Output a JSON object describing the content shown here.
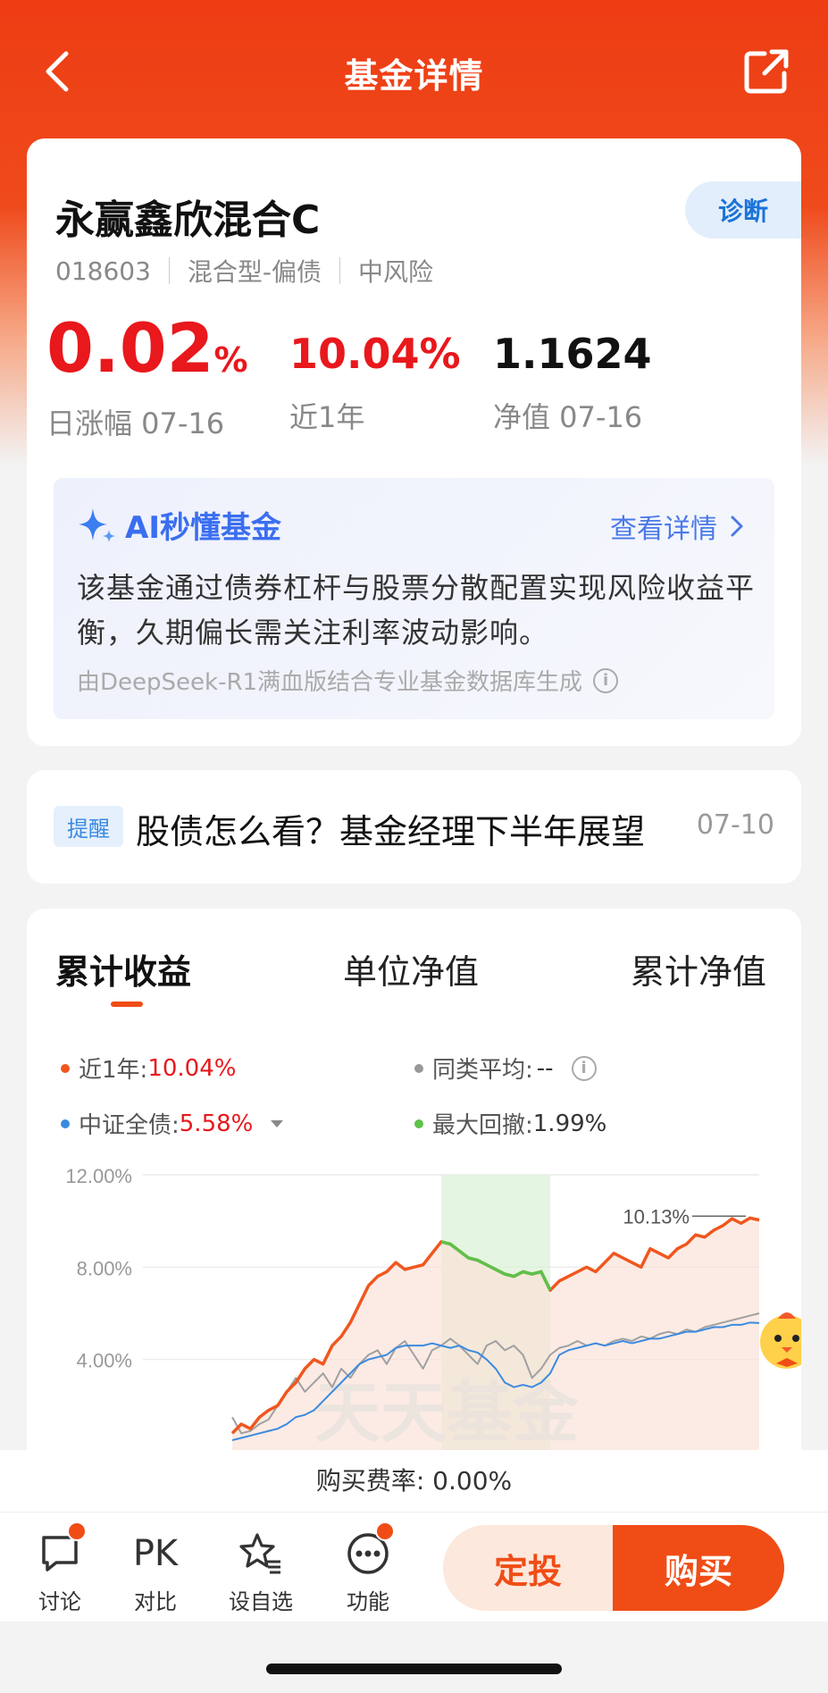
{
  "nav": {
    "title": "基金详情",
    "back_icon": "chevron-left-icon",
    "share_icon": "share-icon"
  },
  "fund": {
    "name": "永赢鑫欣混合C",
    "code": "018603",
    "type": "混合型-偏债",
    "risk": "中风险",
    "diagnose_label": "诊断",
    "daily_change_value": "0.02",
    "daily_change_unit": "%",
    "daily_change_label": "日涨幅 07-16",
    "year_return": "10.04%",
    "year_return_label": "近1年",
    "nav_value": "1.1624",
    "nav_label": "净值 07-16"
  },
  "ai": {
    "title": "AI秒懂基金",
    "link": "查看详情",
    "description": "该基金通过债券杠杆与股票分散配置实现风险收益平衡，久期偏长需关注利率波动影响。",
    "source": "由DeepSeek-R1满血版结合专业基金数据库生成"
  },
  "reminder": {
    "tag": "提醒",
    "text": "股债怎么看？基金经理下半年展望",
    "date": "07-10"
  },
  "chart_tabs": [
    "累计收益",
    "单位净值",
    "累计净值"
  ],
  "legend": {
    "fund_label": "近1年:",
    "fund_value": "10.04%",
    "peer_label": "同类平均:",
    "peer_value": "--",
    "index_label": "中证全债:",
    "index_value": "5.58%",
    "drawdown_label": "最大回撤:",
    "drawdown_value": "1.99%"
  },
  "colors": {
    "accent": "#f04d16",
    "red": "#e8181c",
    "blue": "#3a8ae0",
    "green": "#5cc24a",
    "gray": "#999999"
  },
  "chart_data": {
    "type": "line",
    "y_ticks": [
      "12.00%",
      "8.00%",
      "4.00%"
    ],
    "ylim": [
      0,
      12
    ],
    "peak_label": "10.13%",
    "watermark": "天天基金",
    "series": [
      {
        "name": "近1年",
        "color": "#f0561e",
        "values": [
          0.8,
          1.2,
          1.0,
          1.5,
          1.8,
          2.0,
          2.6,
          3.0,
          3.6,
          4.0,
          3.8,
          4.6,
          5.0,
          5.6,
          6.4,
          7.2,
          7.6,
          7.8,
          8.2,
          7.9,
          8.0,
          8.1,
          8.6,
          9.1,
          9.0,
          8.7,
          8.4,
          8.3,
          8.1,
          7.9,
          7.7,
          7.6,
          7.8,
          7.7,
          7.8,
          7.0,
          7.4,
          7.6,
          7.8,
          8.0,
          7.8,
          8.2,
          8.6,
          8.4,
          8.2,
          8.0,
          8.8,
          8.6,
          8.4,
          8.8,
          9.0,
          9.4,
          9.3,
          9.6,
          9.8,
          10.1,
          9.9,
          10.13,
          10.04
        ]
      },
      {
        "name": "同类平均",
        "color": "#a0a0a0",
        "values": [
          1.5,
          0.8,
          0.9,
          1.2,
          1.4,
          2.0,
          2.6,
          3.2,
          2.6,
          3.0,
          3.4,
          2.8,
          3.6,
          3.2,
          3.8,
          4.2,
          4.4,
          3.8,
          4.5,
          4.8,
          4.2,
          3.6,
          4.4,
          4.6,
          4.9,
          4.6,
          4.2,
          3.8,
          4.6,
          4.8,
          4.4,
          4.6,
          4.2,
          3.2,
          3.6,
          4.2,
          4.5,
          4.6,
          4.8,
          4.6,
          4.7,
          4.6,
          4.8,
          4.9,
          4.8,
          5.0,
          4.9,
          5.1,
          5.2,
          5.1,
          5.3,
          5.2,
          5.4,
          5.5,
          5.6,
          5.7,
          5.8,
          5.9,
          6.0
        ]
      },
      {
        "name": "中证全债",
        "color": "#3a8ae0",
        "values": [
          0.5,
          0.6,
          0.7,
          0.8,
          0.9,
          1.0,
          1.2,
          1.5,
          1.6,
          1.8,
          2.2,
          2.6,
          3.0,
          3.4,
          3.8,
          4.0,
          4.1,
          4.2,
          4.5,
          4.6,
          4.6,
          4.6,
          4.7,
          4.6,
          4.5,
          4.6,
          4.4,
          4.3,
          4.0,
          3.6,
          3.0,
          2.8,
          2.9,
          2.8,
          3.0,
          3.4,
          4.2,
          4.4,
          4.5,
          4.6,
          4.7,
          4.6,
          4.7,
          4.8,
          4.7,
          4.8,
          4.9,
          4.9,
          5.0,
          5.1,
          5.2,
          5.2,
          5.3,
          5.4,
          5.4,
          5.5,
          5.5,
          5.6,
          5.58
        ]
      }
    ],
    "drawdown_range": [
      23,
      35
    ]
  },
  "fee": {
    "text": "购买费率: 0.00%"
  },
  "bottom": {
    "discuss": "讨论",
    "compare_icon_text": "PK",
    "compare": "对比",
    "watchlist": "设自选",
    "functions": "功能",
    "auto_invest": "定投",
    "buy": "购买"
  }
}
